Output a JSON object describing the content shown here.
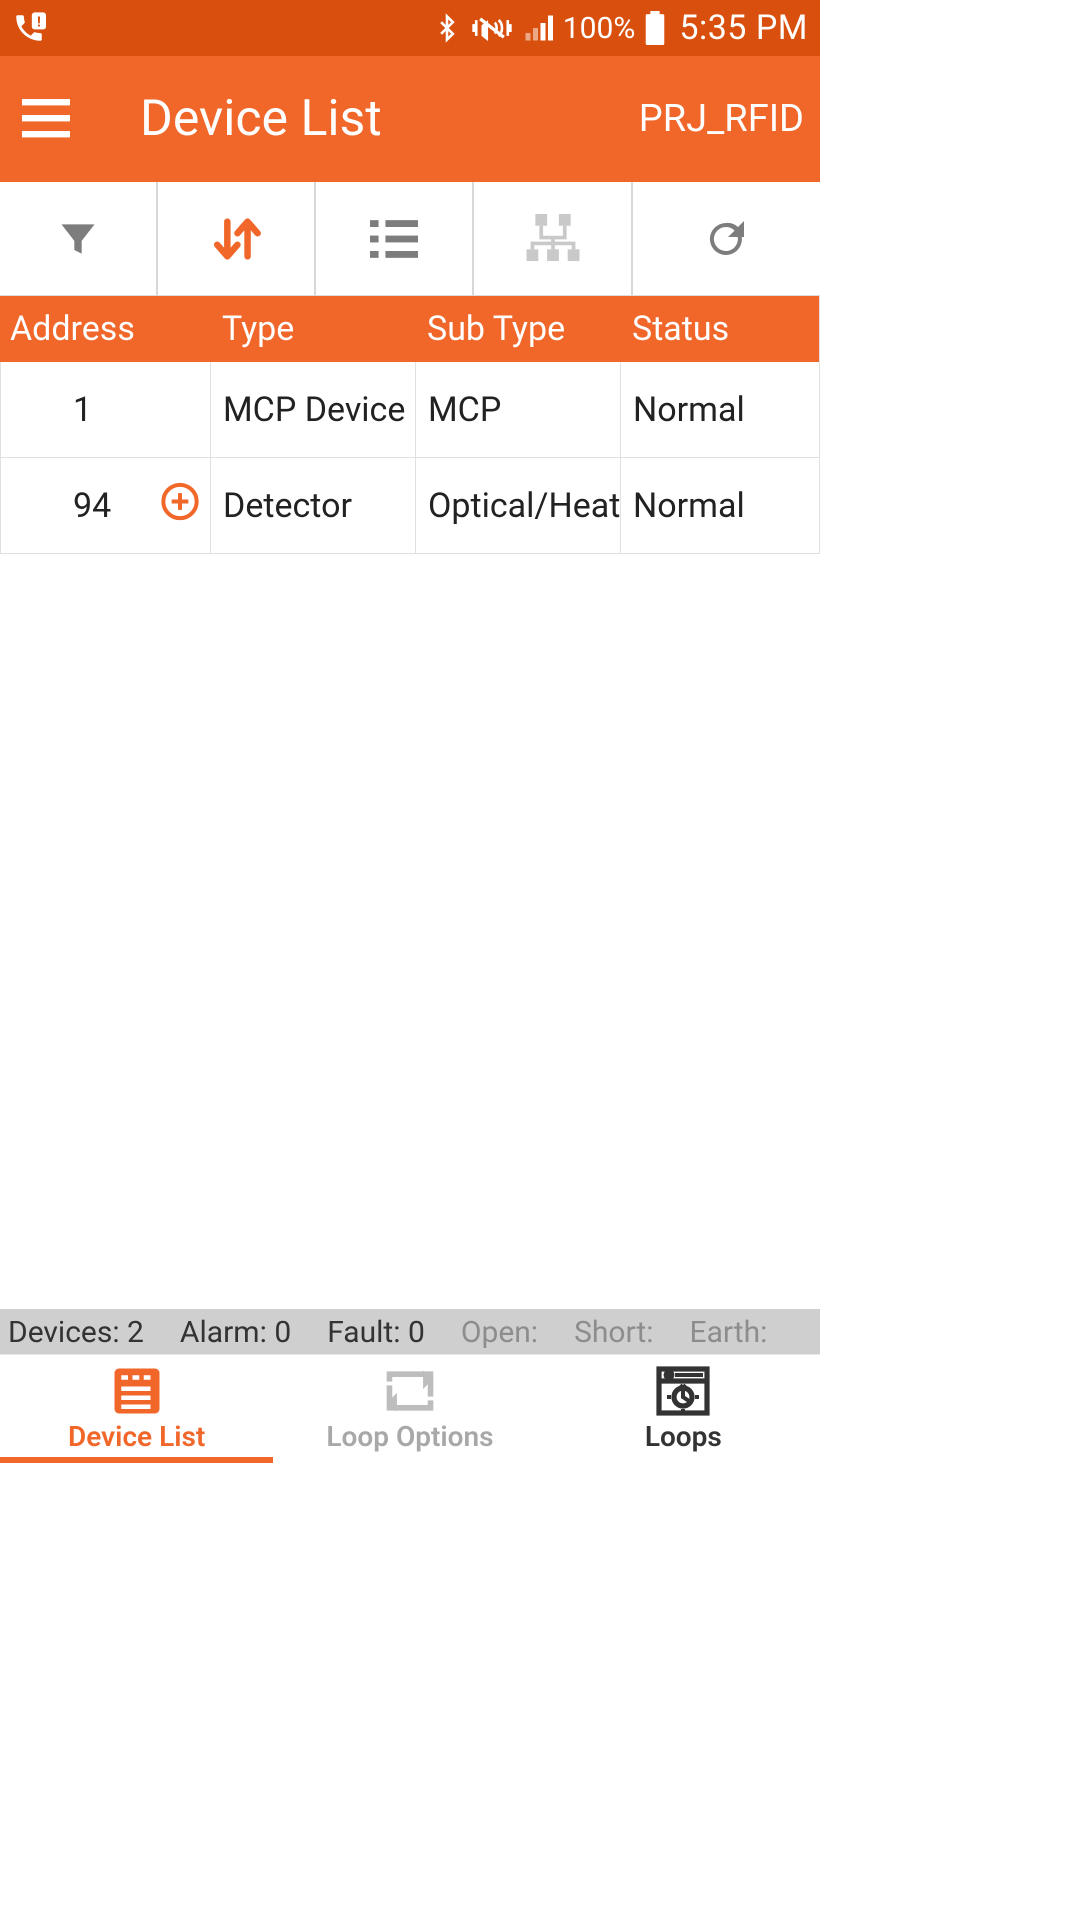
{
  "statusbar": {
    "battery_pct": "100%",
    "time": "5:35 PM"
  },
  "header": {
    "title": "Device List",
    "project": "PRJ_RFID"
  },
  "toolbar": {
    "filter_icon": "filter",
    "sort_icon": "sort",
    "list_icon": "list",
    "tree_icon": "tree",
    "refresh_icon": "refresh"
  },
  "table": {
    "columns": {
      "address": "Address",
      "type": "Type",
      "subtype": "Sub Type",
      "status": "Status"
    },
    "rows": [
      {
        "address": "1",
        "has_add_icon": false,
        "type": "MCP Device",
        "subtype": "MCP",
        "status": "Normal"
      },
      {
        "address": "94",
        "has_add_icon": true,
        "type": "Detector",
        "subtype": "Optical/Heat",
        "status": "Normal"
      }
    ]
  },
  "summary": {
    "devices_label": "Devices:",
    "devices_value": "2",
    "alarm_label": "Alarm:",
    "alarm_value": "0",
    "fault_label": "Fault:",
    "fault_value": "0",
    "open_label": "Open:",
    "short_label": "Short:",
    "earth_label": "Earth:"
  },
  "bottom_nav": {
    "items": [
      {
        "label": "Device List",
        "active": true
      },
      {
        "label": "Loop Options",
        "active": false
      },
      {
        "label": "Loops",
        "active": false
      }
    ]
  }
}
